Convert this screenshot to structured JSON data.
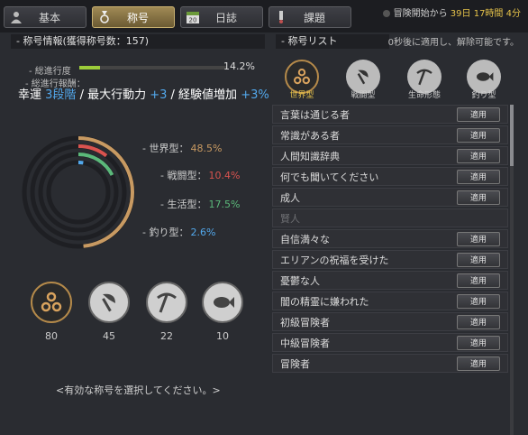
{
  "tabs": [
    {
      "label": "基本",
      "icon": "person-icon",
      "active": false
    },
    {
      "label": "称号",
      "icon": "medal-icon",
      "active": true
    },
    {
      "label": "日誌",
      "icon": "calendar-icon",
      "active": false
    },
    {
      "label": "課題",
      "icon": "scroll-icon",
      "active": false
    }
  ],
  "calendar_day": "20",
  "adventure_time": {
    "prefix": "冒険開始から",
    "days": "39日",
    "hours": "17時間",
    "minutes": "4分"
  },
  "left": {
    "heading": "- 称号情報(獲得称号数：157)",
    "progress_label": "- 総進行度",
    "progress_value": 0.142,
    "progress_text": "14.2%",
    "reward_label": "- 総進行報酬：",
    "reward": {
      "part1": "幸運",
      "part2": "3段階",
      "part3": "/ 最大行動力",
      "part4": "+3",
      "part5": "/ 経験値増加",
      "part6": "+3%"
    },
    "types": [
      {
        "label": "- 世界型：",
        "pct": "48.5%",
        "value": 48.5,
        "color": "#c89a62"
      },
      {
        "label": "- 戦闘型：",
        "pct": "10.4%",
        "value": 10.4,
        "color": "#d9534f"
      },
      {
        "label": "- 生活型：",
        "pct": "17.5%",
        "value": 17.5,
        "color": "#5bb87a"
      },
      {
        "label": "- 釣り型：",
        "pct": "2.6%",
        "value": 2.6,
        "color": "#52a8ec"
      }
    ],
    "counts": [
      "80",
      "45",
      "22",
      "10"
    ],
    "select_prompt": "<有効な称号を選択してください。>"
  },
  "right": {
    "heading": "- 称号リスト",
    "note": "0秒後に適用し、解除可能です。",
    "categories": [
      {
        "label": "世界型",
        "active": true
      },
      {
        "label": "戦闘型",
        "active": false
      },
      {
        "label": "生命形態",
        "active": false
      },
      {
        "label": "釣り型",
        "active": false
      }
    ],
    "apply_label": "適用",
    "titles": [
      {
        "name": "言葉は通じる者",
        "enabled": true
      },
      {
        "name": "常識がある者",
        "enabled": true
      },
      {
        "name": "人間知識辞典",
        "enabled": true
      },
      {
        "name": "何でも聞いてください",
        "enabled": true
      },
      {
        "name": "成人",
        "enabled": true
      },
      {
        "name": "賢人",
        "enabled": false
      },
      {
        "name": "自信満々な",
        "enabled": true
      },
      {
        "name": "エリアンの祝福を受けた",
        "enabled": true
      },
      {
        "name": "憂鬱な人",
        "enabled": true
      },
      {
        "name": "闇の精霊に嫌われた",
        "enabled": true
      },
      {
        "name": "初級冒険者",
        "enabled": true
      },
      {
        "name": "中級冒険者",
        "enabled": true
      },
      {
        "name": "冒険者",
        "enabled": true
      }
    ]
  }
}
